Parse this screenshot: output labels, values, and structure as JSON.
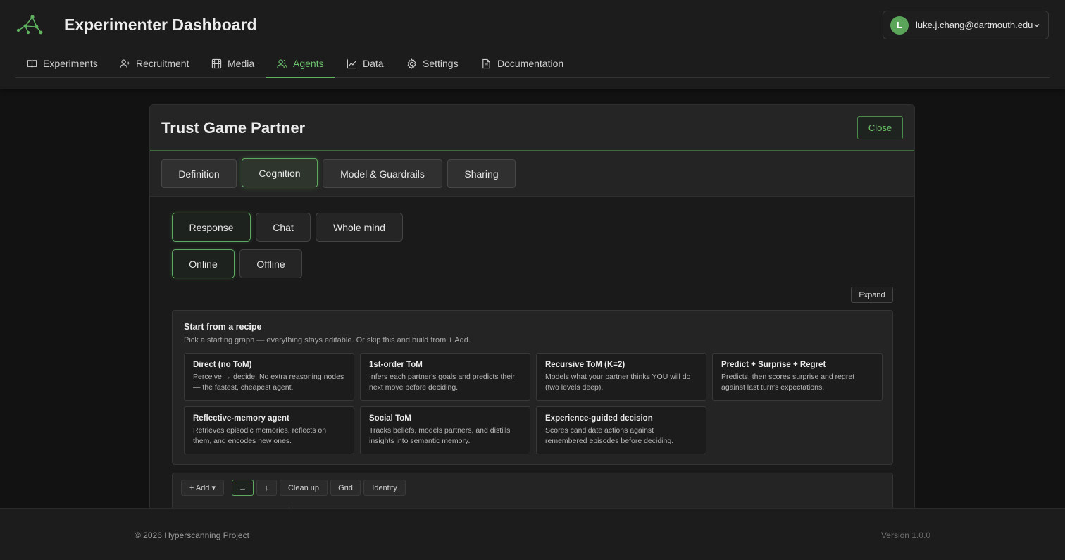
{
  "app": {
    "title": "Experimenter Dashboard"
  },
  "user": {
    "initial": "L",
    "email": "luke.j.chang@dartmouth.edu"
  },
  "nav": {
    "items": [
      {
        "label": "Experiments",
        "icon": "book-open-icon"
      },
      {
        "label": "Recruitment",
        "icon": "user-plus-icon"
      },
      {
        "label": "Media",
        "icon": "film-icon"
      },
      {
        "label": "Agents",
        "icon": "users-icon",
        "active": true
      },
      {
        "label": "Data",
        "icon": "line-chart-icon"
      },
      {
        "label": "Settings",
        "icon": "gear-icon"
      },
      {
        "label": "Documentation",
        "icon": "document-icon"
      }
    ]
  },
  "panel": {
    "title": "Trust Game Partner",
    "close_label": "Close",
    "tabs": [
      {
        "label": "Definition"
      },
      {
        "label": "Cognition",
        "active": true
      },
      {
        "label": "Model & Guardrails"
      },
      {
        "label": "Sharing"
      }
    ],
    "view_modes": [
      {
        "label": "Response",
        "active": true
      },
      {
        "label": "Chat"
      },
      {
        "label": "Whole mind"
      }
    ],
    "timing_modes": [
      {
        "label": "Online",
        "active": true
      },
      {
        "label": "Offline"
      }
    ],
    "expand_label": "Expand"
  },
  "recipes": {
    "title": "Start from a recipe",
    "subtitle": "Pick a starting graph — everything stays editable. Or skip this and build from + Add.",
    "cards": [
      {
        "title": "Direct (no ToM)",
        "desc": "Perceive → decide. No extra reasoning nodes — the fastest, cheapest agent."
      },
      {
        "title": "1st-order ToM",
        "desc": "Infers each partner's goals and predicts their next move before deciding."
      },
      {
        "title": "Recursive ToM (K=2)",
        "desc": "Models what your partner thinks YOU will do (two levels deep)."
      },
      {
        "title": "Predict + Surprise + Regret",
        "desc": "Predicts, then scores surprise and regret against last turn's expectations."
      },
      {
        "title": "Reflective-memory agent",
        "desc": "Retrieves episodic memories, reflects on them, and encodes new ones."
      },
      {
        "title": "Social ToM",
        "desc": "Tracks beliefs, models partners, and distills insights into semantic memory."
      },
      {
        "title": "Experience-guided decision",
        "desc": "Scores candidate actions against remembered episodes before deciding."
      }
    ]
  },
  "toolbar": {
    "add_label": "+ Add ▾",
    "dir_right": "→",
    "dir_down": "↓",
    "cleanup_label": "Clean up",
    "grid_label": "Grid",
    "identity_label": "Identity"
  },
  "footer": {
    "copyright": "© 2026 Hyperscanning Project",
    "version": "Version 1.0.0"
  },
  "colors": {
    "accent": "#5fb35f",
    "background": "#121212"
  }
}
